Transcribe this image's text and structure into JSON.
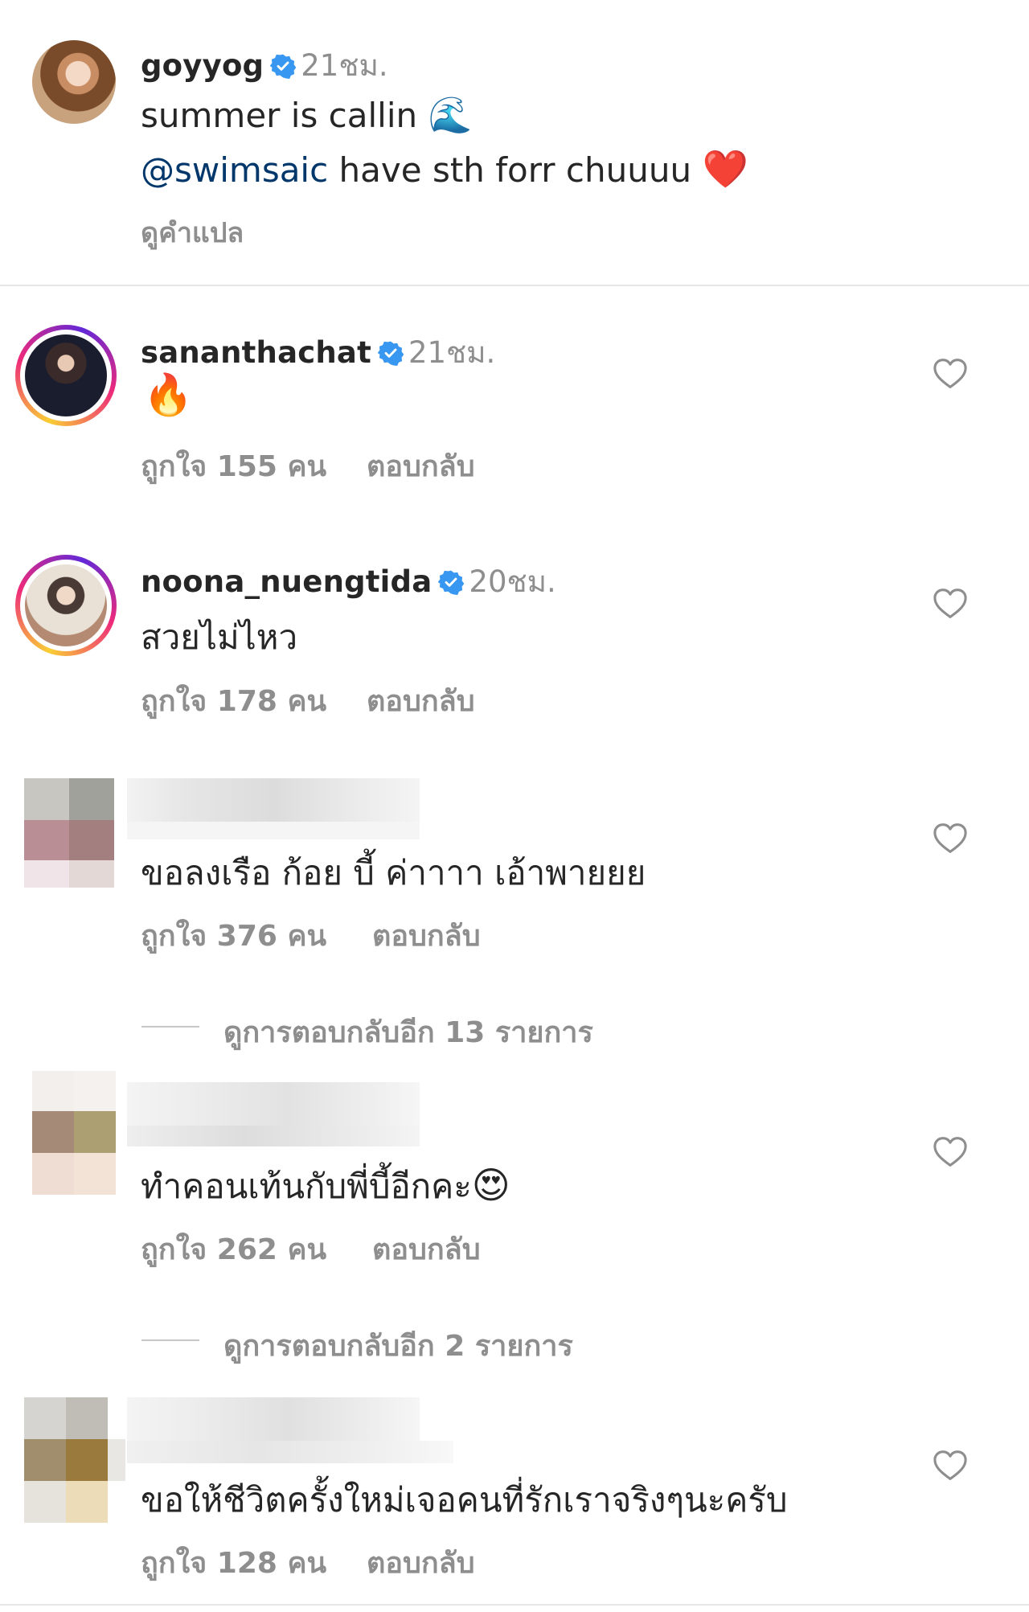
{
  "caption": {
    "username": "goyyog",
    "time": "21ชม.",
    "line1": "summer is callin",
    "line1_emoji": "🌊",
    "mention": "@swimsaic",
    "line2_rest": " have sth forr chuuuu",
    "line2_emoji": "❤️",
    "see_translation": "ดูคำแปล"
  },
  "comments": [
    {
      "username": "sanantha.chat",
      "display_username": "sananthachat",
      "time": "21ชม.",
      "text": "🔥",
      "likes": "ถูกใจ 155 คน",
      "reply": "ตอบกลับ"
    },
    {
      "username": "noona_nuengtida",
      "time": "20ชม.",
      "text": "สวยไม่ไหว",
      "likes": "ถูกใจ 178 คน",
      "reply": "ตอบกลับ"
    },
    {
      "text": "ขอลงเรือ ก้อย บี้ ค่าาาา  เอ้าพายยย",
      "likes": "ถูกใจ 376 คน",
      "reply": "ตอบกลับ",
      "more_replies": "ดูการตอบกลับอีก 13 รายการ"
    },
    {
      "text": "ทำคอนเท้นกับพี่บี้อีกคะ",
      "text_emoji": "😍",
      "likes": "ถูกใจ 262 คน",
      "reply": "ตอบกลับ",
      "more_replies": "ดูการตอบกลับอีก 2 รายการ"
    },
    {
      "text": "ขอให้ชีวิตครั้งใหม่เจอคนที่รักเราจริงๆนะครับ",
      "likes": "ถูกใจ 128 คน",
      "reply": "ตอบกลับ"
    }
  ],
  "icons": {
    "verified": "verified-badge-icon",
    "like": "heart-outline-icon"
  },
  "colors": {
    "verified": "#3897f0",
    "link": "#00376b",
    "muted": "#8e8e8e",
    "divider": "#dbdbdb"
  }
}
